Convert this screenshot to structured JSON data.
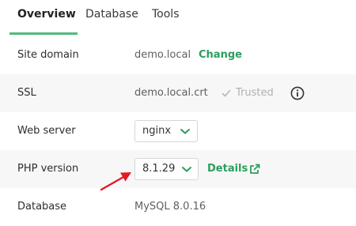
{
  "tabs": [
    {
      "label": "Overview",
      "active": true
    },
    {
      "label": "Database",
      "active": false
    },
    {
      "label": "Tools",
      "active": false
    }
  ],
  "rows": {
    "site_domain": {
      "label": "Site domain",
      "value": "demo.local",
      "action": "Change"
    },
    "ssl": {
      "label": "SSL",
      "value": "demo.local.crt",
      "status": "Trusted"
    },
    "web_server": {
      "label": "Web server",
      "selected": "nginx"
    },
    "php_version": {
      "label": "PHP version",
      "selected": "8.1.29",
      "action": "Details"
    },
    "database": {
      "label": "Database",
      "value": "MySQL 8.0.16"
    }
  },
  "icons": {
    "check": "check-icon",
    "info": "info-icon",
    "external": "external-link-icon",
    "chevron": "chevron-down-icon",
    "arrow": "red-arrow-annotation"
  },
  "colors": {
    "accent": "#51bb7b",
    "link": "#2c9e5d",
    "annotation": "#e31b23",
    "row_shade": "#f7f7f7"
  }
}
